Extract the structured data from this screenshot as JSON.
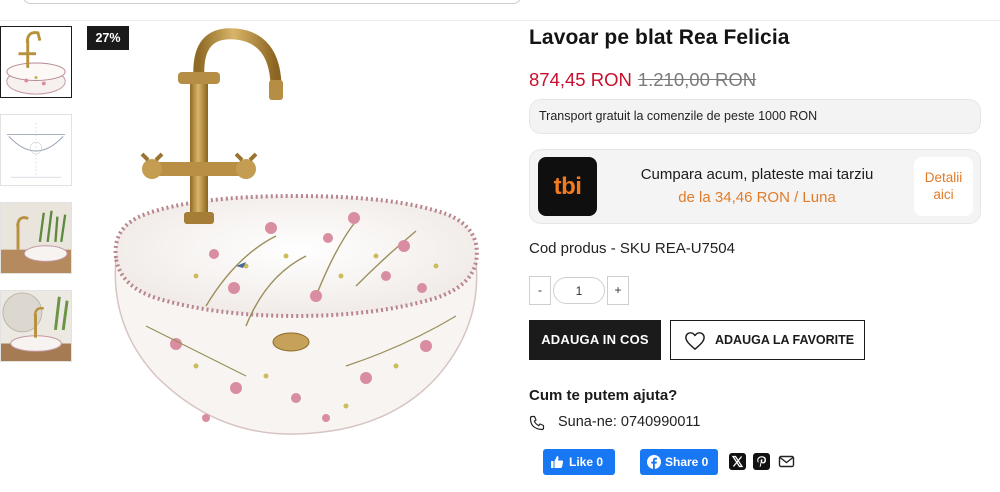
{
  "product": {
    "title": "Lavoar pe blat Rea Felicia",
    "price_current": "874,45 RON",
    "price_old": "1.210,00 RON",
    "discount_badge": "27%",
    "sku_text": "Cod produs - SKU REA-U7504"
  },
  "shipping_notice": "Transport gratuit la comenzile de peste 1000 RON",
  "tbi": {
    "logo_text": "tbi",
    "line1": "Cumpara acum, plateste mai tarziu",
    "line2": "de la 34,46 RON / Luna",
    "details_line1": "Detalii",
    "details_line2": "aici"
  },
  "quantity": {
    "minus": "-",
    "value": "1",
    "plus": "+"
  },
  "actions": {
    "add_to_cart": "ADAUGA IN COS",
    "add_to_favorites": "ADAUGA LA FAVORITE"
  },
  "help": {
    "title": "Cum te putem ajuta?",
    "phone": "Suna-ne: 0740990011"
  },
  "social": {
    "like": "Like 0",
    "share": "Share 0"
  },
  "icons": {
    "heart": "heart-icon",
    "phone": "phone-icon",
    "x": "x-icon",
    "pinterest": "pinterest-icon",
    "email": "email-icon"
  },
  "colors": {
    "price": "#c8102e",
    "tbi_accent": "#e07b28",
    "facebook": "#1877f2",
    "dark": "#1b1b1b"
  },
  "gallery": {
    "thumbnails": [
      "thumb-1",
      "thumb-2",
      "thumb-3",
      "thumb-4"
    ],
    "active_index": 0
  }
}
